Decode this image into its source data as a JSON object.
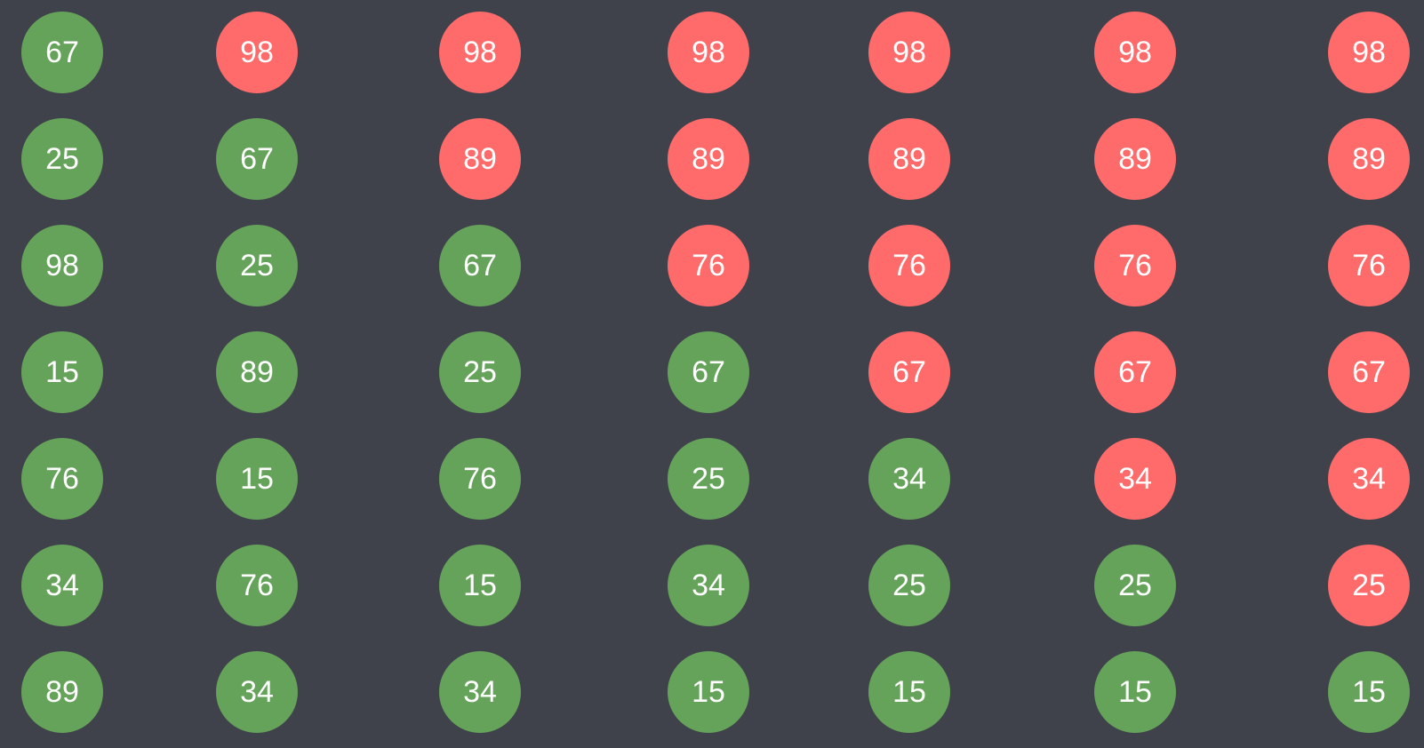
{
  "colors": {
    "background": "#3f424b",
    "sorted": "#66a35a",
    "unsorted": "#ff6b6b",
    "text": "#ffffff"
  },
  "columns": [
    [
      {
        "value": "67",
        "state": "sorted"
      },
      {
        "value": "25",
        "state": "sorted"
      },
      {
        "value": "98",
        "state": "sorted"
      },
      {
        "value": "15",
        "state": "sorted"
      },
      {
        "value": "76",
        "state": "sorted"
      },
      {
        "value": "34",
        "state": "sorted"
      },
      {
        "value": "89",
        "state": "sorted"
      }
    ],
    [
      {
        "value": "98",
        "state": "unsorted"
      },
      {
        "value": "67",
        "state": "sorted"
      },
      {
        "value": "25",
        "state": "sorted"
      },
      {
        "value": "89",
        "state": "sorted"
      },
      {
        "value": "15",
        "state": "sorted"
      },
      {
        "value": "76",
        "state": "sorted"
      },
      {
        "value": "34",
        "state": "sorted"
      }
    ],
    [
      {
        "value": "98",
        "state": "unsorted"
      },
      {
        "value": "89",
        "state": "unsorted"
      },
      {
        "value": "67",
        "state": "sorted"
      },
      {
        "value": "25",
        "state": "sorted"
      },
      {
        "value": "76",
        "state": "sorted"
      },
      {
        "value": "15",
        "state": "sorted"
      },
      {
        "value": "34",
        "state": "sorted"
      }
    ],
    [
      {
        "value": "98",
        "state": "unsorted"
      },
      {
        "value": "89",
        "state": "unsorted"
      },
      {
        "value": "76",
        "state": "unsorted"
      },
      {
        "value": "67",
        "state": "sorted"
      },
      {
        "value": "25",
        "state": "sorted"
      },
      {
        "value": "34",
        "state": "sorted"
      },
      {
        "value": "15",
        "state": "sorted"
      }
    ],
    [
      {
        "value": "98",
        "state": "unsorted"
      },
      {
        "value": "89",
        "state": "unsorted"
      },
      {
        "value": "76",
        "state": "unsorted"
      },
      {
        "value": "67",
        "state": "unsorted"
      },
      {
        "value": "34",
        "state": "sorted"
      },
      {
        "value": "25",
        "state": "sorted"
      },
      {
        "value": "15",
        "state": "sorted"
      }
    ],
    [
      {
        "value": "98",
        "state": "unsorted"
      },
      {
        "value": "89",
        "state": "unsorted"
      },
      {
        "value": "76",
        "state": "unsorted"
      },
      {
        "value": "67",
        "state": "unsorted"
      },
      {
        "value": "34",
        "state": "unsorted"
      },
      {
        "value": "25",
        "state": "sorted"
      },
      {
        "value": "15",
        "state": "sorted"
      }
    ],
    [
      {
        "value": "98",
        "state": "unsorted"
      },
      {
        "value": "89",
        "state": "unsorted"
      },
      {
        "value": "76",
        "state": "unsorted"
      },
      {
        "value": "67",
        "state": "unsorted"
      },
      {
        "value": "34",
        "state": "unsorted"
      },
      {
        "value": "25",
        "state": "unsorted"
      },
      {
        "value": "15",
        "state": "sorted"
      }
    ]
  ]
}
